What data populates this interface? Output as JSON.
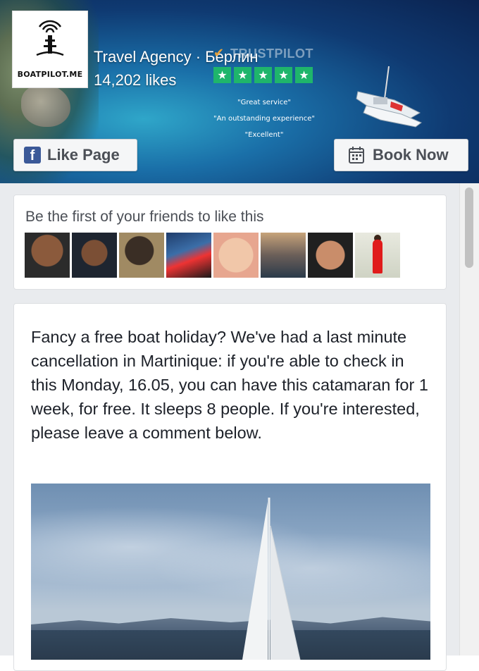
{
  "header": {
    "logo_text": "BOATPILOT.ME",
    "page_name": "Travel Agency · Берлин",
    "likes": "14,202 likes",
    "trustpilot": {
      "brand": "TRUSTPILOT",
      "stars": [
        "★",
        "★",
        "★",
        "★",
        "★"
      ],
      "reviews": [
        "\"Great service\"",
        "\"An outstanding experience\"",
        "\"Excellent\""
      ]
    },
    "like_button": "Like Page",
    "book_button": "Book Now"
  },
  "friends": {
    "title": "Be the first of your friends to like this",
    "faces": [
      {
        "type": "avatar"
      },
      {
        "type": "avatar"
      },
      {
        "type": "avatar"
      },
      {
        "type": "avatar"
      },
      {
        "type": "avatar"
      },
      {
        "type": "avatar"
      },
      {
        "type": "avatar"
      },
      {
        "type": "avatar"
      }
    ]
  },
  "post": {
    "text": "Fancy a free boat holiday? We've had a last minute cancellation in Martinique: if you're able to check in this Monday, 16.05, you can have this catamaran for 1 week, for free. It sleeps 8 people. If you're interested, please leave a comment below."
  },
  "colors": {
    "facebook_blue": "#3b5998",
    "trustpilot_green": "#1fb56b",
    "trustpilot_orange": "#e9a23b",
    "feed_background": "#e9ebee"
  },
  "icons": {
    "logo": "radio-tower-icon",
    "like": "facebook-f-icon",
    "book": "calendar-icon",
    "promo": "catamaran-icon"
  }
}
